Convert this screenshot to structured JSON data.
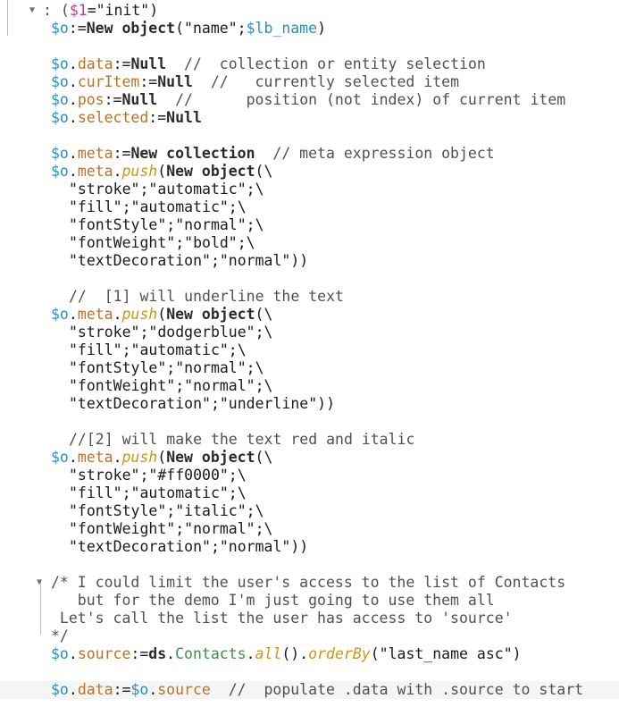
{
  "editor": {
    "lines": [
      {
        "fold": "▼",
        "tokens": [
          [
            "cm",
            ": ("
          ],
          [
            "dol",
            "$1"
          ],
          [
            "pl",
            "=\"init\")"
          ]
        ]
      },
      {
        "tokens": [
          [
            "var",
            "$o"
          ],
          [
            "pl",
            ":="
          ],
          [
            "kw",
            "New object"
          ],
          [
            "pl",
            "(\"name\";"
          ],
          [
            "var",
            "$lb_name"
          ],
          [
            "pl",
            ")"
          ]
        ]
      },
      {
        "tokens": []
      },
      {
        "tokens": [
          [
            "var",
            "$o"
          ],
          [
            "pl",
            "."
          ],
          [
            "prop",
            "data"
          ],
          [
            "pl",
            ":="
          ],
          [
            "kw",
            "Null"
          ],
          [
            "cm",
            "  //  collection or entity selection"
          ]
        ]
      },
      {
        "tokens": [
          [
            "var",
            "$o"
          ],
          [
            "pl",
            "."
          ],
          [
            "prop",
            "curItem"
          ],
          [
            "pl",
            ":="
          ],
          [
            "kw",
            "Null"
          ],
          [
            "cm",
            "  //   currently selected item"
          ]
        ]
      },
      {
        "tokens": [
          [
            "var",
            "$o"
          ],
          [
            "pl",
            "."
          ],
          [
            "prop",
            "pos"
          ],
          [
            "pl",
            ":="
          ],
          [
            "kw",
            "Null"
          ],
          [
            "cm",
            "  //      position (not index) of current item"
          ]
        ]
      },
      {
        "tokens": [
          [
            "var",
            "$o"
          ],
          [
            "pl",
            "."
          ],
          [
            "prop",
            "selected"
          ],
          [
            "pl",
            ":="
          ],
          [
            "kw",
            "Null"
          ]
        ]
      },
      {
        "tokens": []
      },
      {
        "tokens": [
          [
            "var",
            "$o"
          ],
          [
            "pl",
            "."
          ],
          [
            "prop",
            "meta"
          ],
          [
            "pl",
            ":="
          ],
          [
            "kw",
            "New collection"
          ],
          [
            "cm",
            "  // meta expression object"
          ]
        ]
      },
      {
        "tokens": [
          [
            "var",
            "$o"
          ],
          [
            "pl",
            "."
          ],
          [
            "prop",
            "meta"
          ],
          [
            "pl",
            "."
          ],
          [
            "meth",
            "push"
          ],
          [
            "pl",
            "("
          ],
          [
            "kw",
            "New object"
          ],
          [
            "pl",
            "(\\"
          ]
        ]
      },
      {
        "indent": 1,
        "tokens": [
          [
            "pl",
            "\"stroke\";\"automatic\";\\"
          ]
        ]
      },
      {
        "indent": 1,
        "tokens": [
          [
            "pl",
            "\"fill\";\"automatic\";\\"
          ]
        ]
      },
      {
        "indent": 1,
        "tokens": [
          [
            "pl",
            "\"fontStyle\";\"normal\";\\"
          ]
        ]
      },
      {
        "indent": 1,
        "tokens": [
          [
            "pl",
            "\"fontWeight\";\"bold\";\\"
          ]
        ]
      },
      {
        "indent": 1,
        "tokens": [
          [
            "pl",
            "\"textDecoration\";\"normal\"))"
          ]
        ]
      },
      {
        "tokens": []
      },
      {
        "indent": 1,
        "tokens": [
          [
            "cm",
            "//  [1] will underline the text"
          ]
        ]
      },
      {
        "tokens": [
          [
            "var",
            "$o"
          ],
          [
            "pl",
            "."
          ],
          [
            "prop",
            "meta"
          ],
          [
            "pl",
            "."
          ],
          [
            "meth",
            "push"
          ],
          [
            "pl",
            "("
          ],
          [
            "kw",
            "New object"
          ],
          [
            "pl",
            "(\\"
          ]
        ]
      },
      {
        "indent": 1,
        "tokens": [
          [
            "pl",
            "\"stroke\";\"dodgerblue\";\\"
          ]
        ]
      },
      {
        "indent": 1,
        "tokens": [
          [
            "pl",
            "\"fill\";\"automatic\";\\"
          ]
        ]
      },
      {
        "indent": 1,
        "tokens": [
          [
            "pl",
            "\"fontStyle\";\"normal\";\\"
          ]
        ]
      },
      {
        "indent": 1,
        "tokens": [
          [
            "pl",
            "\"fontWeight\";\"normal\";\\"
          ]
        ]
      },
      {
        "indent": 1,
        "tokens": [
          [
            "pl",
            "\"textDecoration\";\"underline\"))"
          ]
        ]
      },
      {
        "tokens": []
      },
      {
        "indent": 1,
        "tokens": [
          [
            "cm",
            "//[2] will make the text red and italic"
          ]
        ]
      },
      {
        "tokens": [
          [
            "var",
            "$o"
          ],
          [
            "pl",
            "."
          ],
          [
            "prop",
            "meta"
          ],
          [
            "pl",
            "."
          ],
          [
            "meth",
            "push"
          ],
          [
            "pl",
            "("
          ],
          [
            "kw",
            "New object"
          ],
          [
            "pl",
            "(\\"
          ]
        ]
      },
      {
        "indent": 1,
        "tokens": [
          [
            "pl",
            "\"stroke\";\"#ff0000\";\\"
          ]
        ]
      },
      {
        "indent": 1,
        "tokens": [
          [
            "pl",
            "\"fill\";\"automatic\";\\"
          ]
        ]
      },
      {
        "indent": 1,
        "tokens": [
          [
            "pl",
            "\"fontStyle\";\"italic\";\\"
          ]
        ]
      },
      {
        "indent": 1,
        "tokens": [
          [
            "pl",
            "\"fontWeight\";\"normal\";\\"
          ]
        ]
      },
      {
        "indent": 1,
        "tokens": [
          [
            "pl",
            "\"textDecoration\";\"normal\"))"
          ]
        ]
      },
      {
        "tokens": []
      },
      {
        "fold": "▼",
        "tokens": [
          [
            "cm",
            "/* I could limit the user's access to the list of Contacts"
          ]
        ]
      },
      {
        "tokens": [
          [
            "cm",
            "   but for the demo I'm just going to use them all"
          ]
        ]
      },
      {
        "tokens": [
          [
            "cm",
            " Let's call the list the user has access to 'source'"
          ]
        ]
      },
      {
        "tokens": [
          [
            "cm",
            "*/"
          ]
        ]
      },
      {
        "tokens": [
          [
            "var",
            "$o"
          ],
          [
            "pl",
            "."
          ],
          [
            "prop",
            "source"
          ],
          [
            "pl",
            ":="
          ],
          [
            "kw",
            "ds"
          ],
          [
            "pl",
            "."
          ],
          [
            "cls",
            "Contacts"
          ],
          [
            "pl",
            "."
          ],
          [
            "meth",
            "all"
          ],
          [
            "pl",
            "()."
          ],
          [
            "meth",
            "orderBy"
          ],
          [
            "pl",
            "(\"last_name asc\")"
          ]
        ]
      },
      {
        "tokens": []
      },
      {
        "current": true,
        "tokens": [
          [
            "var",
            "$o"
          ],
          [
            "pl",
            "."
          ],
          [
            "prop",
            "data"
          ],
          [
            "pl",
            ":="
          ],
          [
            "var",
            "$o"
          ],
          [
            "pl",
            "."
          ],
          [
            "prop",
            "source"
          ],
          [
            "cm",
            "  //  populate .data with .source to start"
          ]
        ]
      }
    ]
  }
}
